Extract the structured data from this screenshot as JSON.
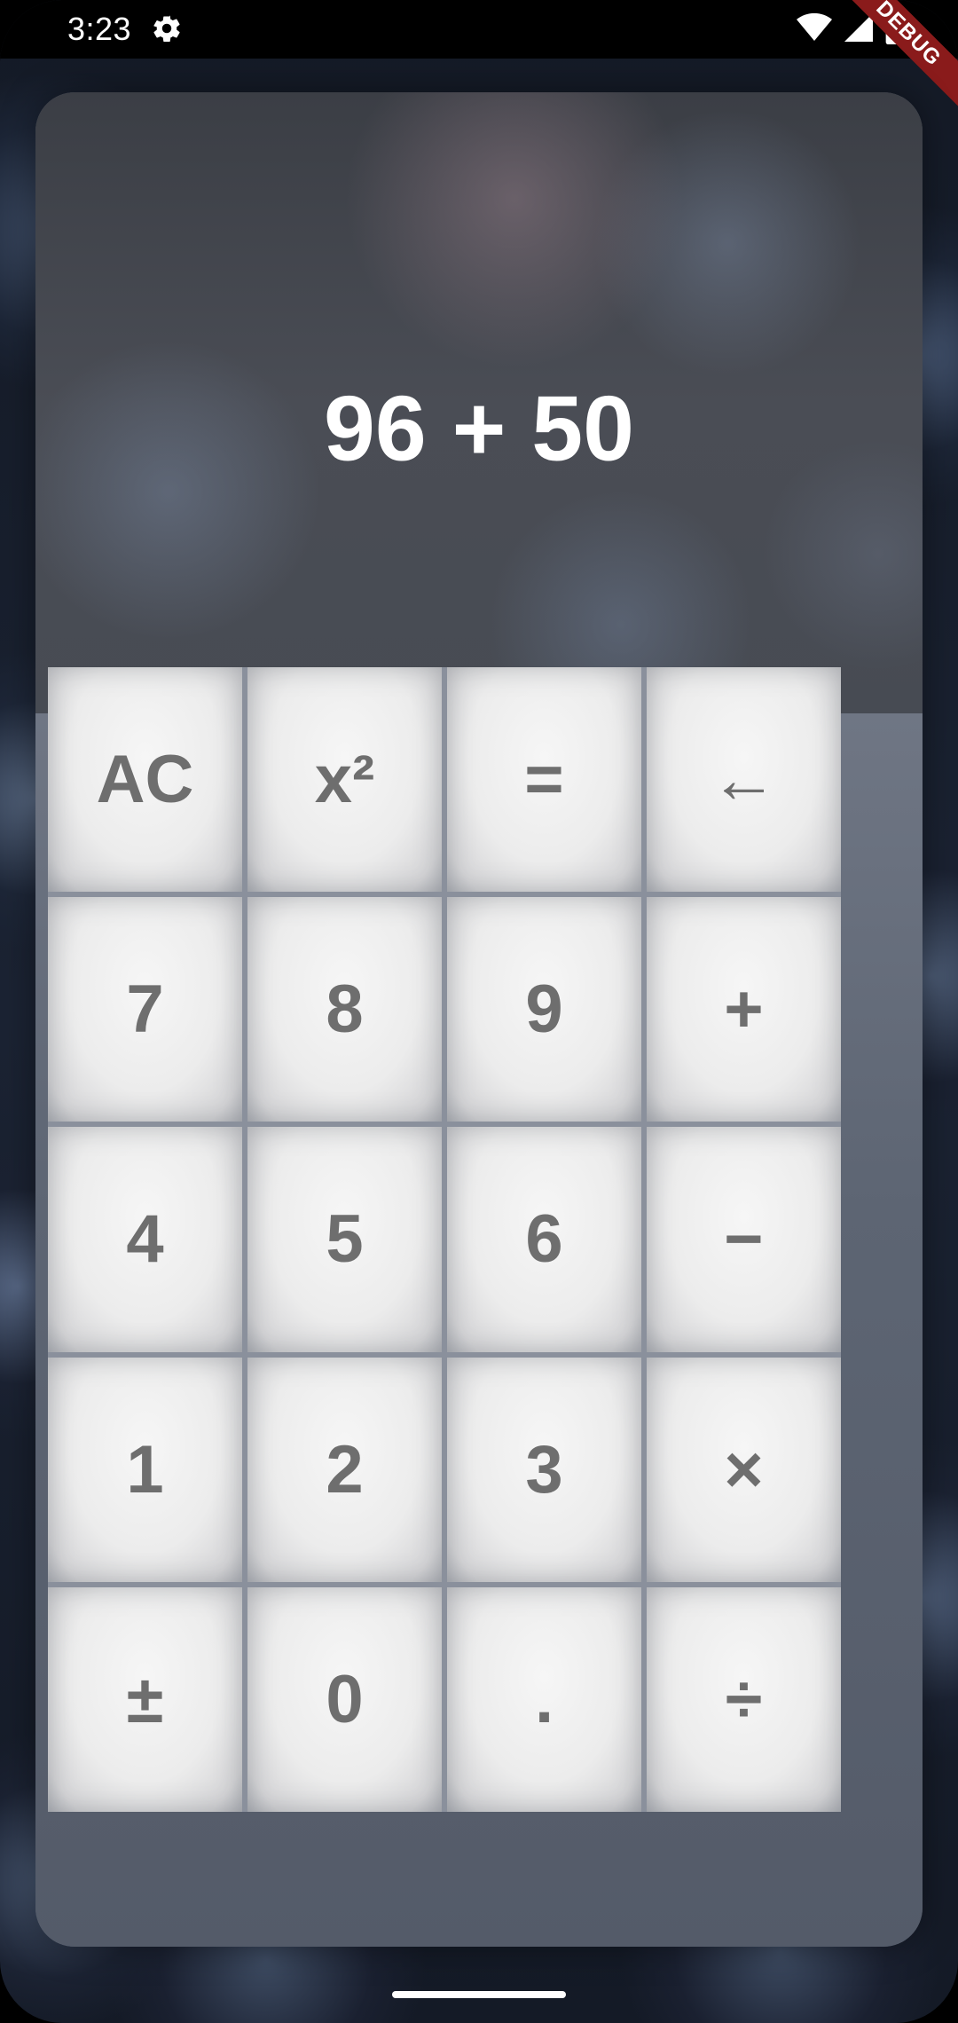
{
  "status_bar": {
    "time": "3:23",
    "icons": [
      "settings-gear-icon",
      "wifi-icon",
      "cellular-signal-icon",
      "battery-icon"
    ]
  },
  "debug_banner": "DEBUG",
  "display": {
    "expression": "96 + 50"
  },
  "keypad": {
    "keys": [
      {
        "label": "AC"
      },
      {
        "label": "x²"
      },
      {
        "label": "="
      },
      {
        "label": "←"
      },
      {
        "label": "7"
      },
      {
        "label": "8"
      },
      {
        "label": "9"
      },
      {
        "label": "+"
      },
      {
        "label": "4"
      },
      {
        "label": "5"
      },
      {
        "label": "6"
      },
      {
        "label": "−"
      },
      {
        "label": "1"
      },
      {
        "label": "2"
      },
      {
        "label": "3"
      },
      {
        "label": "×"
      },
      {
        "label": "±"
      },
      {
        "label": "0"
      },
      {
        "label": "."
      },
      {
        "label": "÷"
      }
    ]
  },
  "colors": {
    "key_text": "#6e6e6e",
    "display_text": "#ffffff",
    "debug_banner": "#8a1b1b"
  }
}
